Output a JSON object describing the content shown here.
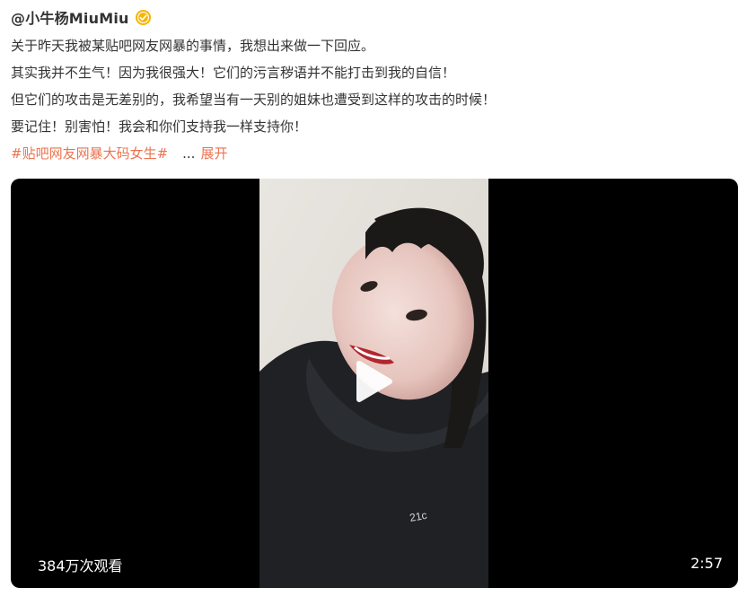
{
  "post": {
    "author": "@小牛杨MiuMiu",
    "verified_icon": "verified-badge-icon",
    "lines": [
      "关于昨天我被某贴吧网友网暴的事情，我想出来做一下回应。",
      "其实我并不生气！因为我很强大！它们的污言秽语并不能打击到我的自信！",
      "但它们的攻击是无差别的，我希望当有一天别的姐妹也遭受到这样的攻击的时候！",
      "要记住！别害怕！我会和你们支持我一样支持你！"
    ],
    "hashtag": "#贴吧网友网暴大码女生#",
    "ellipsis": "...",
    "expand_label": "展开"
  },
  "video": {
    "view_count": "384万次观看",
    "duration": "2:57",
    "play_icon": "play-icon"
  },
  "colors": {
    "accent": "#eb7350",
    "badge": "#f7b500",
    "text": "#333333",
    "video_bg": "#000000"
  }
}
